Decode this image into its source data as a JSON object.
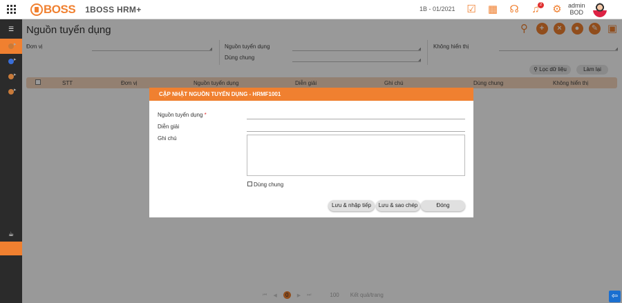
{
  "header": {
    "logo_text": "BOSS",
    "app_name": "1BOSS HRM+",
    "period": "1B - 01/2021",
    "notification_count": "2",
    "user_name": "admin",
    "user_role": "BOD"
  },
  "page": {
    "title": "Nguồn tuyển dụng"
  },
  "filters": {
    "don_vi": "Đơn vị",
    "nguon_tuyen_dung": "Nguồn tuyển dụng",
    "dung_chung": "Dùng chung",
    "khong_hien_thi": "Không hiển thị"
  },
  "actions": {
    "filter_label": "Lọc dữ liệu",
    "reset_label": "Làm lại"
  },
  "grid": {
    "columns": [
      "STT",
      "Đơn vị",
      "Nguồn tuyển dụng",
      "Diễn giải",
      "Ghi chú",
      "Dùng chung",
      "Không hiển thị"
    ]
  },
  "pager": {
    "current_page": "0",
    "page_size": "100",
    "per_page_label": "Kết quả/trang"
  },
  "modal": {
    "title": "CẬP NHẬT NGUỒN TUYỂN DỤNG - HRMF1001",
    "field_source": "Nguồn tuyển dụng",
    "required_mark": "*",
    "field_desc": "Diễn giải",
    "field_note": "Ghi chú",
    "check_shared": "Dùng chung",
    "btn_save_next": "Lưu & nhập tiếp",
    "btn_save_copy": "Lưu & sao chép",
    "btn_close": "Đóng"
  },
  "colors": {
    "accent": "#f08030",
    "sidebar": "#2b2b2b",
    "grid_header": "#f5d6bc"
  }
}
